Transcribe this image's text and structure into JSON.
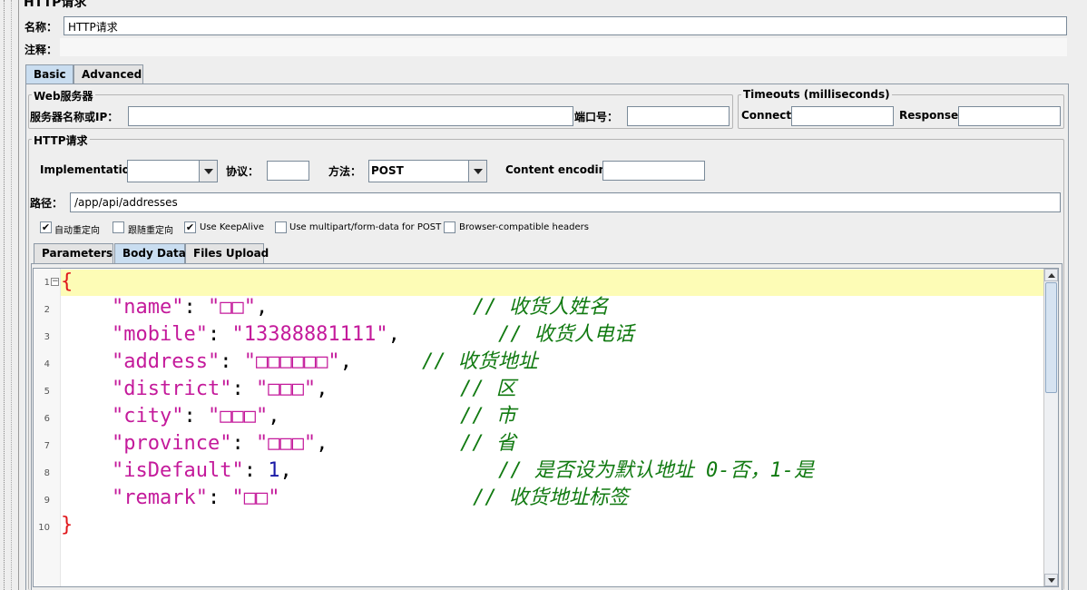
{
  "header": {
    "title": "HTTP请求"
  },
  "form": {
    "name_label": "名称：",
    "name_value": "HTTP请求",
    "comment_label": "注释："
  },
  "main_tabs": [
    {
      "label": "Basic"
    },
    {
      "label": "Advanced"
    }
  ],
  "web_server": {
    "group_title": "Web服务器",
    "server_label": "服务器名称或IP：",
    "port_label": "端口号：",
    "server_value": "",
    "port_value": ""
  },
  "timeouts": {
    "group_title": "Timeouts (milliseconds)",
    "connect_label": "Connect:",
    "response_label": "Response:"
  },
  "http_request": {
    "group_title": "HTTP请求",
    "implementation_label": "Implementation:",
    "implementation_value": "",
    "protocol_label": "协议：",
    "protocol_value": "",
    "method_label": "方法：",
    "method_value": "POST",
    "encoding_label": "Content encoding:",
    "path_label": "路径：",
    "path_value": "/app/api/addresses"
  },
  "options": [
    {
      "label": "自动重定向",
      "checked": true
    },
    {
      "label": "跟随重定向",
      "checked": false
    },
    {
      "label": "Use KeepAlive",
      "checked": true
    },
    {
      "label": "Use multipart/form-data for POST",
      "checked": false
    },
    {
      "label": "Browser-compatible headers",
      "checked": false
    }
  ],
  "body_tabs": [
    {
      "label": "Parameters"
    },
    {
      "label": "Body Data"
    },
    {
      "label": "Files Upload"
    }
  ],
  "editor": {
    "line_numbers": [
      "1",
      "2",
      "3",
      "4",
      "5",
      "6",
      "7",
      "8",
      "9",
      "10"
    ],
    "open_brace": "{",
    "close_brace": "}",
    "lines": [
      {
        "key": "\"name\"",
        "value": "\"□□\"",
        "sep": ",",
        "comment": "// 收货人姓名"
      },
      {
        "key": "\"mobile\"",
        "value": "\"13388881111\"",
        "sep": ",",
        "comment": "// 收货人电话"
      },
      {
        "key": "\"address\"",
        "value": "\"□□□□□□\"",
        "sep": ",",
        "comment": "// 收货地址"
      },
      {
        "key": "\"district\"",
        "value": "\"□□□\"",
        "sep": ",",
        "comment": "// 区"
      },
      {
        "key": "\"city\"",
        "value": "\"□□□\"",
        "sep": ",",
        "comment": "// 市"
      },
      {
        "key": "\"province\"",
        "value": "\"□□□\"",
        "sep": ",",
        "comment": "// 省"
      },
      {
        "key": "\"isDefault\"",
        "value": "1",
        "sep": ",",
        "comment": "// 是否设为默认地址 0-否，1-是"
      },
      {
        "key": "\"remark\"",
        "value": "\"□□\"",
        "sep": "",
        "comment": "// 收货地址标签"
      }
    ]
  },
  "colors": {
    "key": "#c41a9b",
    "number": "#1a1aa6",
    "comment": "#117a11",
    "brace": "#e0161b",
    "highlight": "#fdfcb6"
  }
}
